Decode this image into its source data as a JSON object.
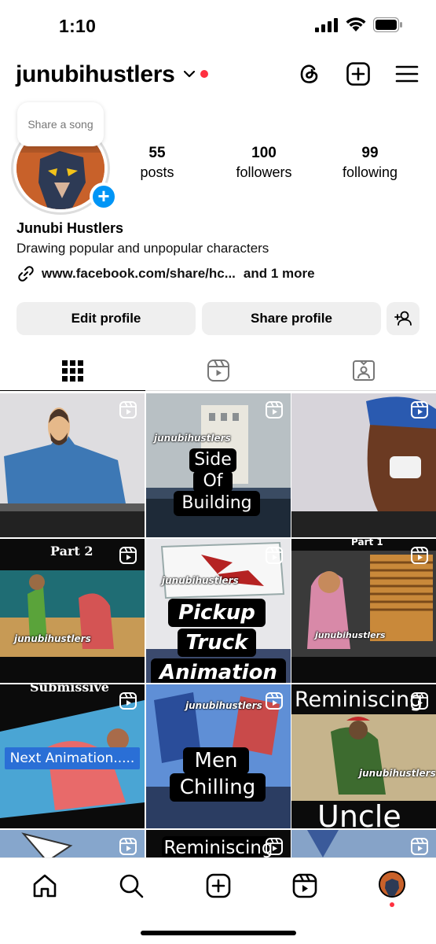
{
  "status": {
    "time": "1:10"
  },
  "header": {
    "username": "junubihustlers"
  },
  "profile": {
    "song_prompt": "Share a song",
    "stats": [
      {
        "value": "55",
        "label": "posts"
      },
      {
        "value": "100",
        "label": "followers"
      },
      {
        "value": "99",
        "label": "following"
      }
    ],
    "display_name": "Junubi Hustlers",
    "bio": "Drawing popular and unpopular characters",
    "link": "www.facebook.com/share/hc...",
    "link_more": "and 1 more"
  },
  "actions": {
    "edit": "Edit profile",
    "share": "Share profile"
  },
  "tabs": [
    "grid-tab",
    "reels-tab",
    "tagged-tab"
  ],
  "posts": [
    {
      "watermark": "",
      "caption": []
    },
    {
      "watermark": "junubihustlers",
      "caption": [
        "Side",
        "Of",
        "Building"
      ]
    },
    {
      "watermark": "",
      "caption": []
    },
    {
      "top_label": "Part 2",
      "watermark": "junubihustlers"
    },
    {
      "watermark": "junubihustlers",
      "caption": [
        "Pickup",
        "Truck",
        "Animation"
      ]
    },
    {
      "top_label": "Part 1",
      "watermark": "junubihustlers"
    },
    {
      "top_label": "Submissive",
      "caption": [
        "Next Animation....."
      ]
    },
    {
      "watermark": "junubihustlers",
      "caption": [
        "Men",
        "Chilling"
      ]
    },
    {
      "top_label": "Reminiscing",
      "watermark": "junubihustlers",
      "caption": [
        "Uncle"
      ],
      "tag": "down"
    },
    {
      "caption": []
    },
    {
      "caption": [
        "Reminiscing"
      ]
    },
    {
      "caption": []
    }
  ],
  "colors": {
    "accent": "#0095f6",
    "notification": "#ff3040"
  }
}
